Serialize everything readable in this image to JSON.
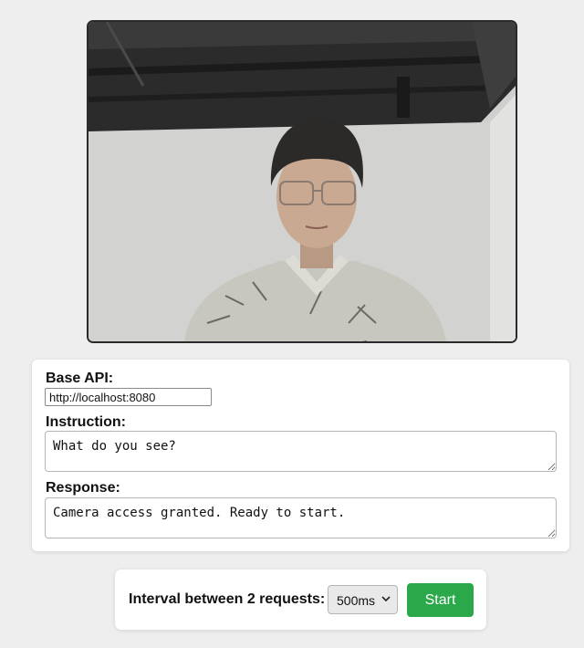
{
  "video": {
    "icon": "camera-feed"
  },
  "form": {
    "base_api_label": "Base API:",
    "base_api_value": "http://localhost:8080",
    "instruction_label": "Instruction:",
    "instruction_value": "What do you see?",
    "response_label": "Response:",
    "response_value": "Camera access granted. Ready to start."
  },
  "controls": {
    "interval_label": "Interval between 2 requests:",
    "interval_selected": "500ms",
    "start_label": "Start",
    "start_color": "#2aa84a"
  }
}
